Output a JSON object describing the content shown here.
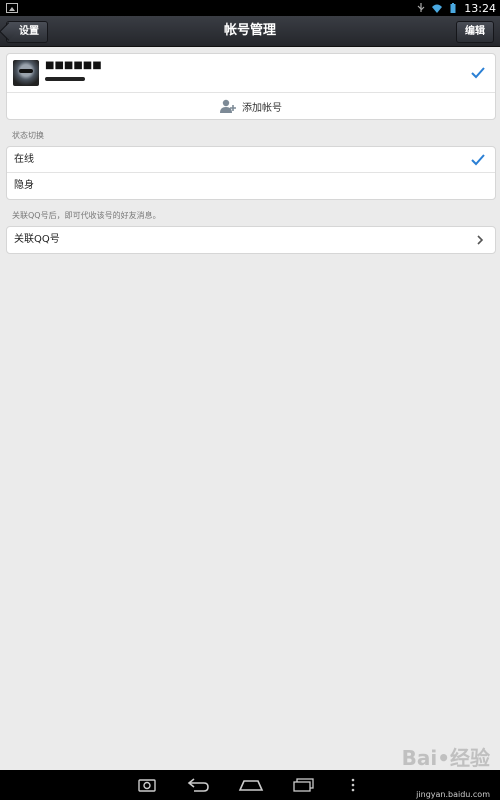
{
  "status_bar": {
    "time": "13:24"
  },
  "header": {
    "title": "帐号管理",
    "back_label": "设置",
    "edit_label": "编辑"
  },
  "account": {
    "name": "■■■■■■",
    "add_label": "添加帐号"
  },
  "status_section": {
    "label": "状态切换",
    "options": [
      {
        "label": "在线",
        "selected": true
      },
      {
        "label": "隐身",
        "selected": false
      }
    ]
  },
  "link_section": {
    "hint": "关联QQ号后，即可代收该号的好友消息。",
    "label": "关联QQ号"
  },
  "watermark": {
    "brand": "Bai•经验",
    "url": "jingyan.baidu.com"
  },
  "colors": {
    "accent": "#2a7fd4",
    "titlebar": "#2d3036",
    "background": "#ebebeb"
  }
}
